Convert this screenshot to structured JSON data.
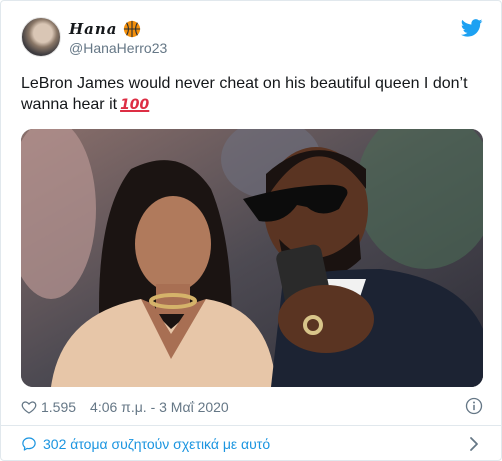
{
  "author": {
    "display_name": "Hana",
    "emoji": "basketball-icon",
    "handle": "@HanaHerro23"
  },
  "tweet": {
    "text": "LeBron James would never cheat on his beautiful queen I don’t wanna hear it",
    "emoji": "hundred-points-icon"
  },
  "meta": {
    "likes": "1.595",
    "timestamp": "4:06 π.μ. - 3 Μαΐ 2020"
  },
  "footer": {
    "conversation": "302 άτομα συζητούν σχετικά με αυτό"
  },
  "colors": {
    "twitter_blue": "#1da1f2",
    "link_blue": "#1b95e0",
    "muted": "#657786",
    "emoji_red": "#dd2e44"
  }
}
